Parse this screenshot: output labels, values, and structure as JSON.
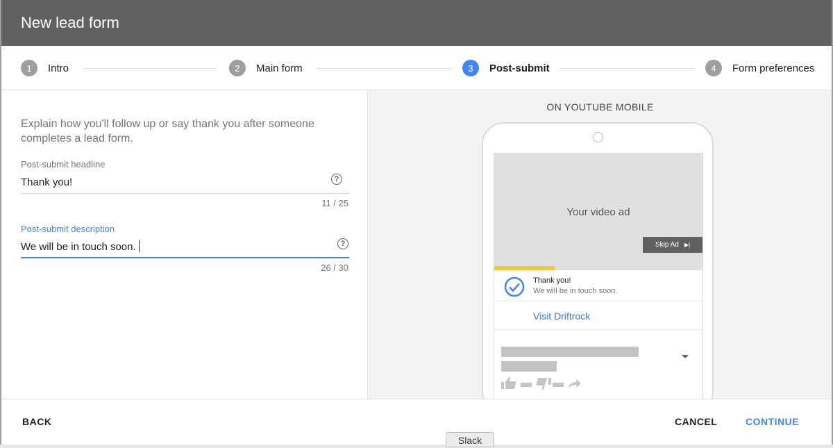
{
  "header": {
    "title": "New lead form"
  },
  "stepper": {
    "steps": [
      {
        "num": "1",
        "label": "Intro"
      },
      {
        "num": "2",
        "label": "Main form"
      },
      {
        "num": "3",
        "label": "Post-submit",
        "active": true
      },
      {
        "num": "4",
        "label": "Form preferences"
      }
    ]
  },
  "form": {
    "explain": "Explain how you'll follow up or say thank you after someone completes a lead form.",
    "headline": {
      "label": "Post-submit headline",
      "value": "Thank you!",
      "counter": "11 / 25"
    },
    "description": {
      "label": "Post-submit description",
      "value": "We will be in touch soon.",
      "counter": "26 / 30"
    },
    "help_glyph": "?"
  },
  "preview": {
    "title": "ON YOUTUBE MOBILE",
    "video_label": "Your video ad",
    "skip_label": "Skip Ad",
    "skip_glyph": "▶|",
    "progress": 0.29,
    "thanks_title": "Thank you!",
    "thanks_desc": "We will be in touch soon.",
    "visit_link": "Visit Driftrock"
  },
  "footer": {
    "back": "BACK",
    "cancel": "CANCEL",
    "continue": "CONTINUE"
  },
  "taskbar": {
    "slack": "Slack"
  },
  "colors": {
    "accent": "#4285f4",
    "header": "#616161",
    "progress": "#f4c542"
  }
}
